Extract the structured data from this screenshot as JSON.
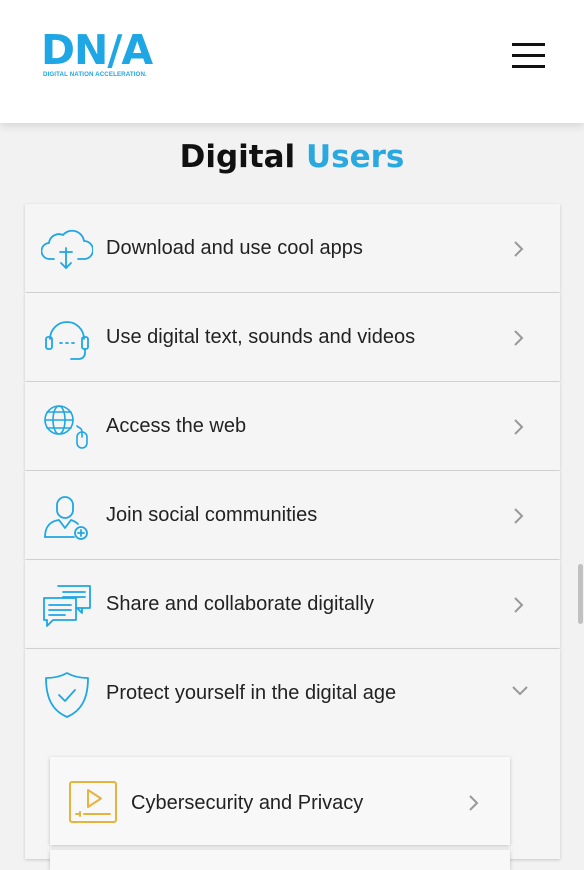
{
  "header": {
    "logo_text": "DN/A",
    "logo_subtitle": "DIGITAL NATION ACCELERATION."
  },
  "section": {
    "title_part1": "Digital",
    "title_part2": "Users"
  },
  "items": [
    {
      "label": "Download and use cool apps",
      "icon": "cloud-download-icon"
    },
    {
      "label": "Use digital text, sounds and videos",
      "icon": "headset-icon"
    },
    {
      "label": "Access the web",
      "icon": "globe-mouse-icon"
    },
    {
      "label": "Join social communities",
      "icon": "user-add-icon"
    },
    {
      "label": "Share and collaborate digitally",
      "icon": "chat-bubbles-icon"
    },
    {
      "label": "Protect yourself in the digital age",
      "icon": "shield-check-icon"
    }
  ],
  "subitems": [
    {
      "label": "Cybersecurity and Privacy",
      "icon": "video-player-icon"
    }
  ],
  "colors": {
    "accent": "#2aa8e0",
    "logo": "#1ea7e4",
    "sub_icon": "#e6b33d"
  }
}
